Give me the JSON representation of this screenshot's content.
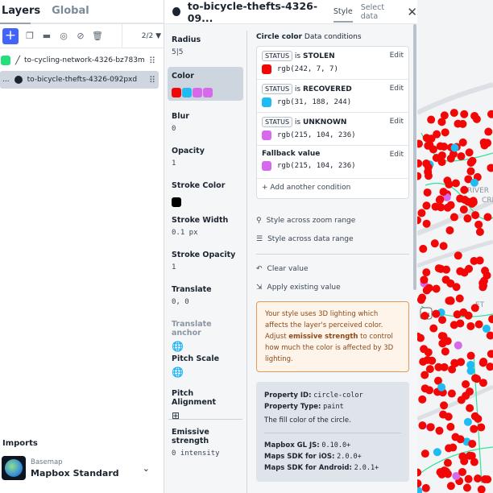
{
  "left": {
    "tabs": [
      "Layers",
      "Global"
    ],
    "count": "2/2",
    "layers": [
      {
        "name": "to-cycling-network-4326-bz783m",
        "color": "#22e07a"
      },
      {
        "name": "to-bicycle-thefts-4326-092pxd",
        "prefix": "..."
      }
    ],
    "imports": {
      "title": "Imports",
      "label": "Basemap",
      "name": "Mapbox Standard"
    }
  },
  "panel": {
    "title": "to-bicycle-thefts-4326-09...",
    "tabs": [
      "Style",
      "Select data"
    ],
    "props": [
      {
        "label": "Radius",
        "value": "5|5"
      },
      {
        "label": "Color",
        "swatches": [
          "#f20707",
          "#1fbcf4",
          "#d768ec",
          "#d768ec"
        ]
      },
      {
        "label": "Blur",
        "value": "0"
      },
      {
        "label": "Opacity",
        "value": "1"
      },
      {
        "label": "Stroke Color",
        "color": "#000000"
      },
      {
        "label": "Stroke Width",
        "value": "0.1 px"
      },
      {
        "label": "Stroke Opacity",
        "value": "1"
      },
      {
        "label": "Translate",
        "value": "0, 0"
      },
      {
        "label": "Translate anchor"
      },
      {
        "label": "Pitch Scale"
      },
      {
        "label": "Pitch Alignment"
      },
      {
        "label": "Emissive strength",
        "value": "0 intensity"
      }
    ],
    "detail": {
      "heading": "Circle color",
      "sub": "Data conditions",
      "edit": "Edit",
      "is": "is",
      "conditions": [
        {
          "field": "STATUS",
          "value": "STOLEN",
          "rgb": "rgb(242, 7, 7)",
          "color": "#f20707"
        },
        {
          "field": "STATUS",
          "value": "RECOVERED",
          "rgb": "rgb(31, 188, 244)",
          "color": "#1fbcf4"
        },
        {
          "field": "STATUS",
          "value": "UNKNOWN",
          "rgb": "rgb(215, 104, 236)",
          "color": "#d768ec"
        }
      ],
      "fallback": {
        "label": "Fallback value",
        "rgb": "rgb(215, 104, 236)",
        "color": "#d768ec"
      },
      "add": "Add another condition",
      "zoom_range": "Style across zoom range",
      "data_range": "Style across data range",
      "clear": "Clear value",
      "apply": "Apply existing value",
      "warning": {
        "pre": "Your style uses 3D lighting which affects the layer's perceived color. Adjust ",
        "bold": "emissive strength",
        "post": " to control how much the color is affected by 3D lighting."
      },
      "info": {
        "id_label": "Property ID:",
        "id": "circle-color",
        "type_label": "Property Type:",
        "type": "paint",
        "desc": "The fill color of the circle.",
        "sdks": [
          {
            "label": "Mapbox GL JS:",
            "v": "0.10.0+"
          },
          {
            "label": "Maps SDK for iOS:",
            "v": "2.0.0+"
          },
          {
            "label": "Maps SDK for Android:",
            "v": "2.0.1+"
          }
        ]
      }
    }
  },
  "map": {
    "labels": [
      "RIVER",
      "CRE",
      "ET",
      "401"
    ]
  }
}
